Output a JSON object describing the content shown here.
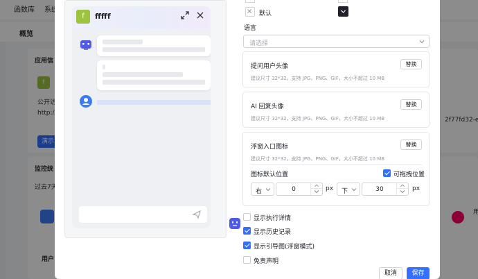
{
  "background": {
    "nav": [
      "函数库",
      "系统"
    ],
    "breadcrumb": "概览",
    "section_app": "应用信",
    "public_access_prefix": "公开访",
    "url_prefix": "http://",
    "url_suffix": "2f77fd32-e",
    "demo_button": "演示",
    "section_monitor": "监控统",
    "period_select": "过去7天",
    "user_label": "用户",
    "side_mark": "用",
    "app_letter": "f"
  },
  "preview": {
    "app_letter": "f",
    "app_title": "fffff"
  },
  "settings": {
    "default_label": "默认",
    "language_label": "语言",
    "language_placeholder": "请选择",
    "replace_label": "替换",
    "ask_avatar": {
      "title": "提问用户头像",
      "hint": "建议尺寸 32*32，支持 JPG、PNG、GIF，大小不超过 10 MB"
    },
    "ai_avatar": {
      "title": "AI 回复头像",
      "hint": "建议尺寸 32*32，支持 JPG、PNG、GIF，大小不超过 10 MB"
    },
    "float_icon": {
      "title": "浮窗入口图标",
      "hint": "建议尺寸 32*32，支持 JPG、PNG、GIF，大小不超过 10 MB",
      "position_label": "图标默认位置",
      "draggable_label": "可拖拽位置",
      "horizontal_select": "右",
      "horizontal_value": "0",
      "vertical_select": "下",
      "vertical_value": "30",
      "unit": "px"
    },
    "checkboxes": [
      {
        "label": "显示执行详情",
        "checked": false
      },
      {
        "label": "显示历史记录",
        "checked": true
      },
      {
        "label": "显示引导图(浮窗模式)",
        "checked": true
      },
      {
        "label": "免责声明",
        "checked": false
      }
    ]
  },
  "footer": {
    "cancel": "取消",
    "save": "保存"
  },
  "colors": {
    "primary": "#3370ff",
    "logo_green": "#9dc33f",
    "overlay": "rgba(0,0,0,0.45)"
  }
}
